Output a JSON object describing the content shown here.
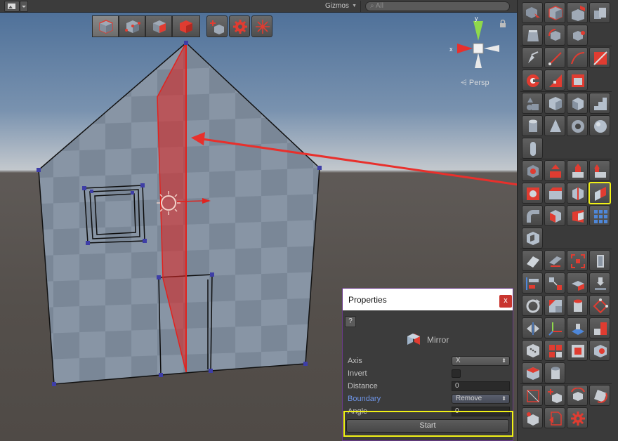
{
  "topbar": {
    "gizmos_label": "Gizmos",
    "search_placeholder": "All"
  },
  "scene": {
    "persp_label": "Persp",
    "view_axes": {
      "x": "x",
      "y": "y"
    }
  },
  "properties": {
    "title": "Properties",
    "close_label": "x",
    "help_label": "?",
    "tool_name": "Mirror",
    "rows": [
      {
        "label": "Axis",
        "value": "X",
        "kind": "dropdown"
      },
      {
        "label": "Invert",
        "checked": false,
        "kind": "checkbox"
      },
      {
        "label": "Distance",
        "value": "0",
        "kind": "field"
      },
      {
        "label": "Boundary",
        "value": "Remove",
        "kind": "dropdown",
        "label_color": "#6e95e8"
      },
      {
        "label": "Angle",
        "value": "0",
        "kind": "field"
      }
    ],
    "start_label": "Start"
  },
  "colors": {
    "accent_red": "#e03c31",
    "highlight_yellow": "#f1f116",
    "mirror_plane": "#e0231f"
  },
  "palette": {
    "highlighted_tool": "mirror-tool-icon"
  }
}
